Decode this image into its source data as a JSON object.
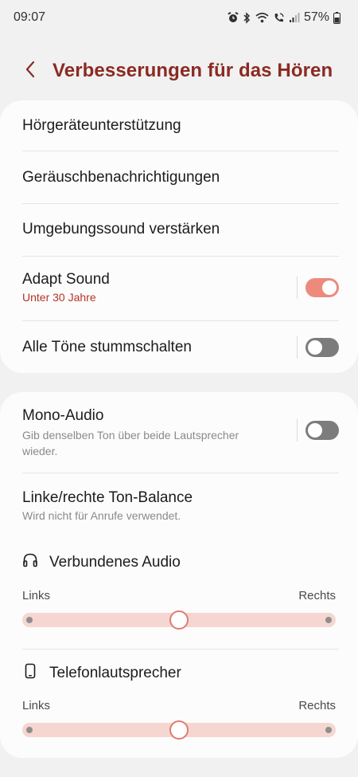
{
  "status": {
    "time": "09:07",
    "battery": "57%",
    "icons": [
      "alarm-icon",
      "bluetooth-icon",
      "wifi-icon",
      "wifi-calling-icon",
      "signal-icon",
      "battery-icon"
    ]
  },
  "header": {
    "title": "Verbesserungen für das Hören",
    "back_icon": "chevron-left-icon"
  },
  "group1": {
    "items": [
      {
        "title": "Hörgeräteunterstützung"
      },
      {
        "title": "Geräuschbenachrichtigungen"
      },
      {
        "title": "Umgebungssound verstärken"
      },
      {
        "title": "Adapt Sound",
        "subtitle": "Unter 30 Jahre",
        "toggle": true
      },
      {
        "title": "Alle Töne stummschalten",
        "toggle": false
      }
    ]
  },
  "group2": {
    "mono": {
      "title": "Mono-Audio",
      "subtitle": "Gib denselben Ton über beide Lautsprecher wieder.",
      "toggle": false
    },
    "balance": {
      "title": "Linke/rechte Ton-Balance",
      "subtitle": "Wird nicht für Anrufe verwendet."
    },
    "connected": {
      "label": "Verbundenes Audio",
      "icon": "headphones-icon",
      "left": "Links",
      "right": "Rechts",
      "value": 0.5
    },
    "phone": {
      "label": "Telefonlautsprecher",
      "icon": "phone-icon",
      "left": "Links",
      "right": "Rechts",
      "value": 0.5
    }
  },
  "colors": {
    "accent": "#8b2a23",
    "toggle_on": "#ec8a7e",
    "toggle_off": "#7c7c7c",
    "slider_track": "#f6d6d1"
  }
}
